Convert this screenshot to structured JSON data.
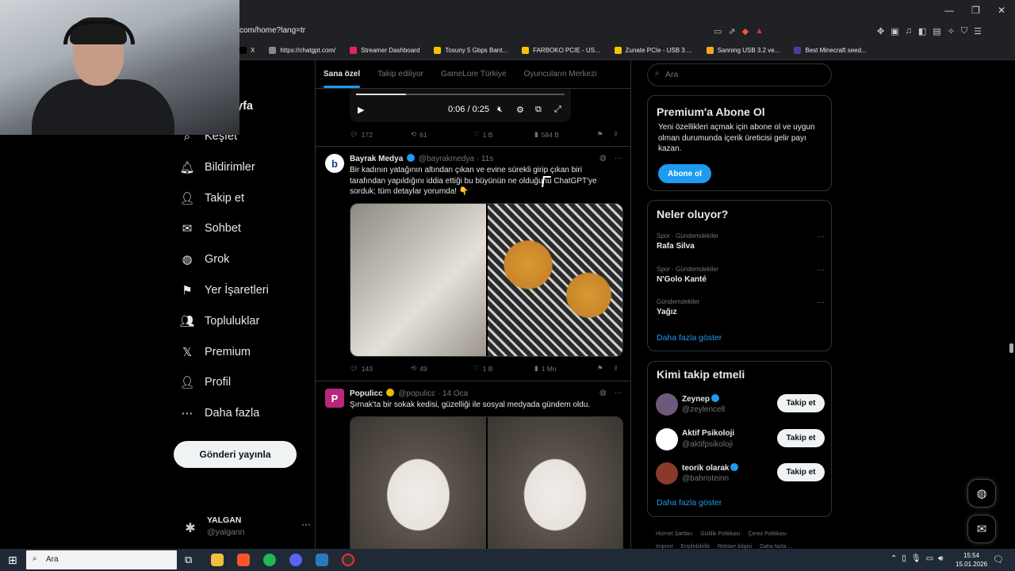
{
  "browser": {
    "url": "com/home?lang=tr",
    "bookmarks": [
      "X",
      "https://chatgpt.com/",
      "Streamer Dashboard",
      "Tosuny 5 Gbps Bant...",
      "FARBOKO PCIE - US...",
      "Zunate PCIe - USB 3....",
      "Sanning USB 3.2 ve...",
      "Best Minecraft seed..."
    ],
    "bookmark_colors": [
      "#000000",
      "#888888",
      "#e0245e",
      "#f5c400",
      "#f5c400",
      "#f5c400",
      "#f5a623",
      "#4b3f9e"
    ]
  },
  "sidebar": {
    "partial_label": "yfa",
    "items": [
      {
        "label": "Keşfet",
        "icon": "search-icon"
      },
      {
        "label": "Bildirimler",
        "icon": "bell-icon"
      },
      {
        "label": "Takip et",
        "icon": "follow-user-icon"
      },
      {
        "label": "Sohbet",
        "icon": "mail-icon"
      },
      {
        "label": "Grok",
        "icon": "grok-icon"
      },
      {
        "label": "Yer İşaretleri",
        "icon": "bookmark-icon"
      },
      {
        "label": "Topluluklar",
        "icon": "communities-icon"
      },
      {
        "label": "Premium",
        "icon": "x-logo-icon"
      },
      {
        "label": "Profil",
        "icon": "profile-icon"
      },
      {
        "label": "Daha fazla",
        "icon": "more-circle-icon"
      }
    ],
    "post_button": "Gönderi yayınla",
    "account": {
      "name": "YALGAN",
      "handle": "@yalgann",
      "more": "···"
    }
  },
  "feed": {
    "tabs": [
      "Sana özel",
      "Takip ediliyor",
      "GameLore Türkiye",
      "Oyuncuların Merkezi"
    ],
    "active_tab": 0,
    "video": {
      "time": "0:06 / 0:25",
      "progress": 0.24
    },
    "video_actions": {
      "replies": "172",
      "reposts": "61",
      "likes": "1 B",
      "views": "584 B"
    },
    "tweets": [
      {
        "name": "Bayrak Medya",
        "handle": "@bayrakmedya",
        "time": "11s",
        "avatar_letter": "b",
        "avatar_color": "#ffffff",
        "avatar_text_color": "#1a3a8a",
        "verified_color": "#1d9bf0",
        "text": "Bir kadının yatağının altından çıkan ve evine sürekli girip çıkan biri tarafından yapıldığını iddia ettiği bu büyünün ne olduğunu ChatGPT'ye sorduk; tüm detaylar yorumda! 👇",
        "actions": {
          "replies": "143",
          "reposts": "49",
          "likes": "1 B",
          "views": "1 Mn"
        }
      },
      {
        "name": "Populicc",
        "handle": "@populicc",
        "time": "14 Oca",
        "avatar_letter": "P",
        "avatar_color": "#b8277b",
        "avatar_text_color": "#ffffff",
        "verified_color": "#e8b80e",
        "text": "Şırnak'ta bir sokak kedisi, güzelliği ile sosyal medyada gündem oldu."
      }
    ]
  },
  "right": {
    "search_placeholder": "Ara",
    "premium": {
      "title": "Premium'a Abone Ol",
      "text": "Yeni özellikleri açmak için abone ol ve uygun olman durumunda içerik üreticisi gelir payı kazan.",
      "button": "Abone ol"
    },
    "trends": {
      "title": "Neler oluyor?",
      "items": [
        {
          "category": "Spor · Gündemdekiler",
          "name": "Rafa Silva"
        },
        {
          "category": "Spor · Gündemdekiler",
          "name": "N'Golo Kanté"
        },
        {
          "category": "Gündemdekiler",
          "name": "Yağız"
        }
      ],
      "show_more": "Daha fazla göster"
    },
    "who_to_follow": {
      "title": "Kimi takip etmeli",
      "items": [
        {
          "name": "Zeynep",
          "handle": "@zeylencell",
          "verified": true,
          "avatar_color": "#6d5a7a"
        },
        {
          "name": "Aktif Psikoloji",
          "handle": "@aktifpsikoloji",
          "verified": false,
          "avatar_color": "#ffffff"
        },
        {
          "name": "teorik olarak",
          "handle": "@bahristeinn",
          "verified": true,
          "avatar_color": "#8a3a2a"
        }
      ],
      "button": "Takip et",
      "show_more": "Daha fazla göster"
    },
    "footer": [
      "Hizmet Şartları",
      "Gizlilik Politikası",
      "Çerez Politikası",
      "Imprint",
      "Erişilebilirlik",
      "Reklam bilgisi",
      "Daha fazla ..."
    ]
  },
  "taskbar": {
    "search": "Ara",
    "time": "15:54",
    "date": "15.01.2026"
  }
}
